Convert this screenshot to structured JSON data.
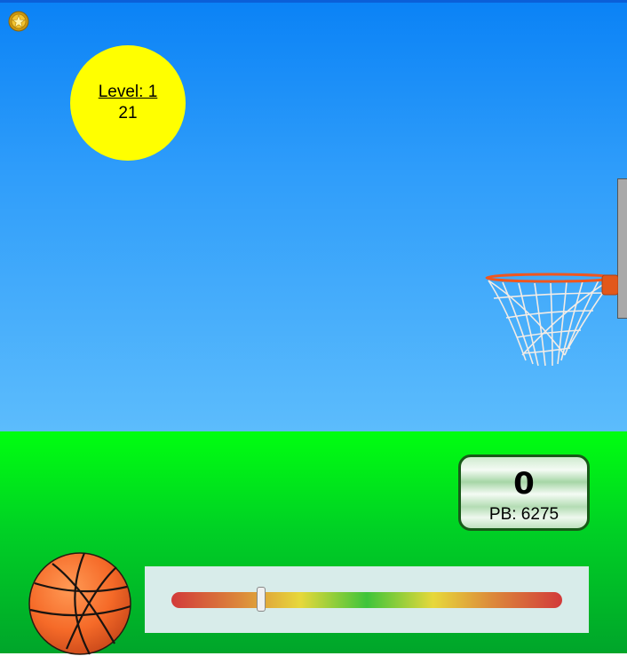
{
  "hud": {
    "level_label": "Level: 1",
    "timer": "21"
  },
  "score": {
    "current": "0",
    "personal_best": "PB: 6275"
  },
  "power_meter": {
    "value_percent": 23
  },
  "colors": {
    "sky_top": "#0a82f6",
    "sky_bottom": "#5cbcfc",
    "ground_top": "#00ff10",
    "ground_bottom": "#00a52a",
    "sun": "#ffff00",
    "ball": "#f56a28",
    "rim": "#f0561e"
  },
  "icons": {
    "coin": "coin-icon",
    "ball": "basketball-icon"
  }
}
